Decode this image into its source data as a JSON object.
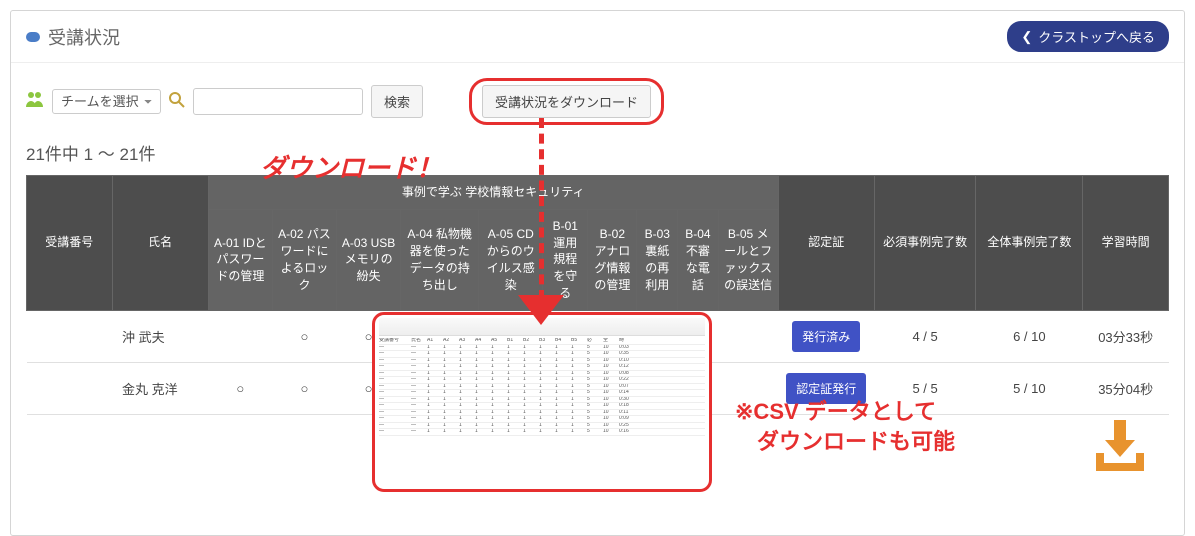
{
  "header": {
    "title": "受講状況",
    "back_label": "クラストップへ戻る"
  },
  "controls": {
    "team_select_placeholder": "チームを選択",
    "search_btn": "検索",
    "download_btn": "受講状況をダウンロード"
  },
  "count_label": "21件中 1 ～ 21件",
  "columns": {
    "id": "受講番号",
    "name": "氏名",
    "group_title": "事例で学ぶ 学校情報セキュリティ",
    "a01": "A-01 IDとパスワードの管理",
    "a02": "A-02 パスワードによるロック",
    "a03": "A-03 USBメモリの紛失",
    "a04": "A-04 私物機器を使ったデータの持ち出し",
    "a05": "A-05 CDからのウイルス感染",
    "b01": "B-01 運用規程を守る",
    "b02": "B-02 アナログ情報の管理",
    "b03": "B-03 裏紙の再利用",
    "b04": "B-04 不審な電話",
    "b05": "B-05 メールとファックスの誤送信",
    "cert": "認定証",
    "need_done": "必須事例完了数",
    "all_done": "全体事例完了数",
    "time": "学習時間"
  },
  "rows": [
    {
      "id": "",
      "name": "沖 武夫",
      "a01": "",
      "a02": "○",
      "a03": "○",
      "a04": "",
      "a05": "",
      "b01": "",
      "b02": "",
      "b03": "",
      "b04": "",
      "b05": "",
      "cert_btn": "発行済み",
      "need_done": "4 / 5",
      "all_done": "6 / 10",
      "time": "03分33秒"
    },
    {
      "id": "",
      "name": "金丸 克洋",
      "a01": "○",
      "a02": "○",
      "a03": "○",
      "a04": "",
      "a05": "",
      "b01": "",
      "b02": "",
      "b03": "",
      "b04": "",
      "b05": "",
      "cert_btn": "認定証発行",
      "need_done": "5 / 5",
      "all_done": "5 / 10",
      "time": "35分04秒"
    }
  ],
  "annotations": {
    "download_label": "ダウンロード！",
    "csv_text_1": "※CSV データとして",
    "csv_text_2": "　ダウンロードも可能"
  }
}
